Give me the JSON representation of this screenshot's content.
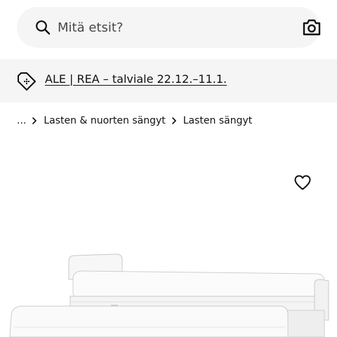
{
  "search": {
    "placeholder": "Mitä etsit?",
    "search_icon": "search-icon",
    "camera_icon": "camera-icon"
  },
  "promo": {
    "icon": "price-tag-icon",
    "text": "ALE | REA – talviale 22.12.–11.1."
  },
  "breadcrumb": {
    "items": [
      "...",
      "Lasten & nuorten sängyt",
      "Lasten sängyt"
    ],
    "separator_icon": "chevron-right-icon"
  },
  "product": {
    "favourite_icon": "heart-icon",
    "image": "white-childrens-bed-with-pull-out-bed"
  },
  "colors": {
    "search_bg": "#f5f5f5",
    "banner_bg": "#f5f5f5",
    "text": "#111111"
  }
}
